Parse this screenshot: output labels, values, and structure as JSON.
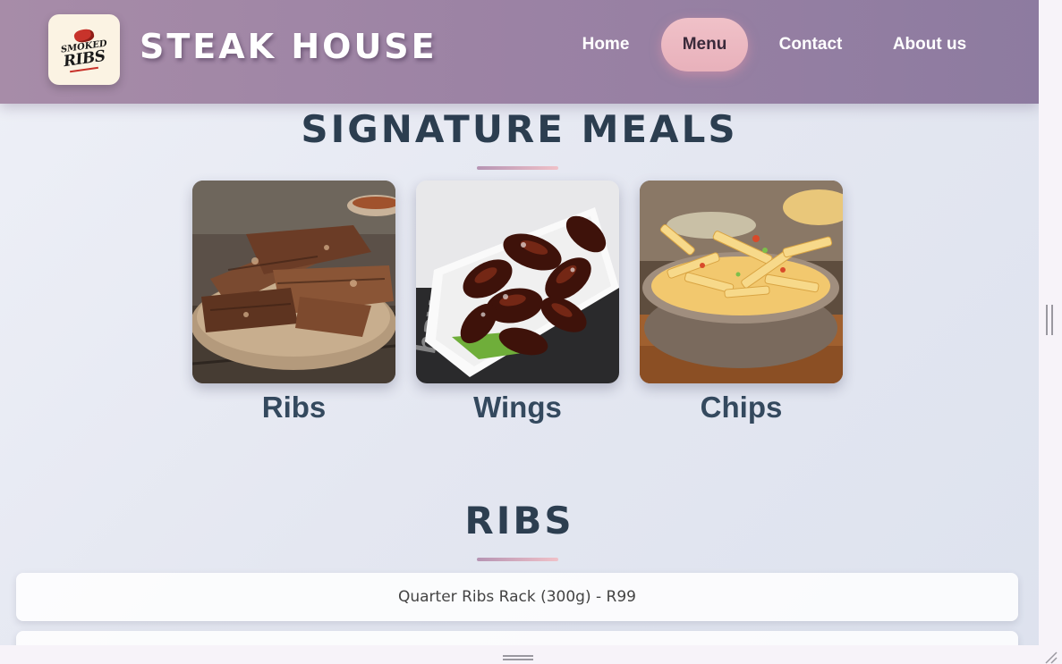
{
  "header": {
    "logo_text_top": "SMOKED",
    "logo_text_bottom": "RIBS",
    "site_title": "STEAK HOUSE",
    "nav": [
      {
        "label": "Home",
        "active": false
      },
      {
        "label": "Menu",
        "active": true
      },
      {
        "label": "Contact",
        "active": false
      },
      {
        "label": "About us",
        "active": false
      }
    ]
  },
  "signature": {
    "title": "SIGNATURE MEALS",
    "cards": [
      {
        "label": "Ribs",
        "image": "ribs-photo"
      },
      {
        "label": "Wings",
        "image": "wings-photo"
      },
      {
        "label": "Chips",
        "image": "chips-photo"
      }
    ]
  },
  "ribs_section": {
    "title": "RIBS",
    "items": [
      {
        "text": "Quarter Ribs Rack (300g) - R99"
      },
      {
        "text": ""
      }
    ]
  },
  "colors": {
    "header_start": "#a78ca8",
    "header_end": "#8d7ba0",
    "accent_pink": "#f0c1c8",
    "heading": "#2c3e50"
  }
}
